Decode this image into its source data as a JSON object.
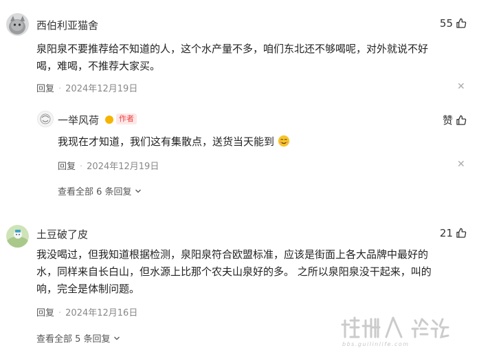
{
  "comments": [
    {
      "username": "西伯利亚猫舍",
      "likes": "55",
      "text_lines": [
        "泉阳泉不要推荐给不知道的人，这个水产量不多，咱们东北还不够喝呢，对外就说不好",
        "喝，难喝，不推荐大家买。"
      ],
      "reply_label": "回复",
      "date": "2024年12月19日",
      "reply": {
        "username": "一举风荷",
        "badge": "作者",
        "like_label": "赞",
        "text": "我现在才知道，我们这有集散点，送货当天能到",
        "reply_label": "回复",
        "date": "2024年12月19日"
      },
      "view_all": "查看全部 6 条回复"
    },
    {
      "username": "土豆破了皮",
      "likes": "21",
      "text_lines": [
        "我没喝过，但我知道根据检测，泉阳泉符合欧盟标准，应该是街面上各大品牌中最好的",
        "水，同样来自长白山，但水源上比那个农夫山泉好的多。 之所以泉阳泉没干起来，叫的",
        "响，完全是体制问题。"
      ],
      "reply_label": "回复",
      "date": "2024年12月16日",
      "view_all": "查看全部 5 条回复"
    }
  ],
  "icons": {
    "close": "close-icon",
    "like": "thumbs-up-icon",
    "chevron": "chevron-down-icon",
    "emoji": "smiling-face-emoji"
  },
  "colors": {
    "author_badge_text": "#f04142",
    "author_badge_bg": "#fde8e8",
    "verified": "#f5b400"
  },
  "watermark": {
    "main": "桂林人 论坛",
    "sub": "bbs.guilinlife.com"
  }
}
